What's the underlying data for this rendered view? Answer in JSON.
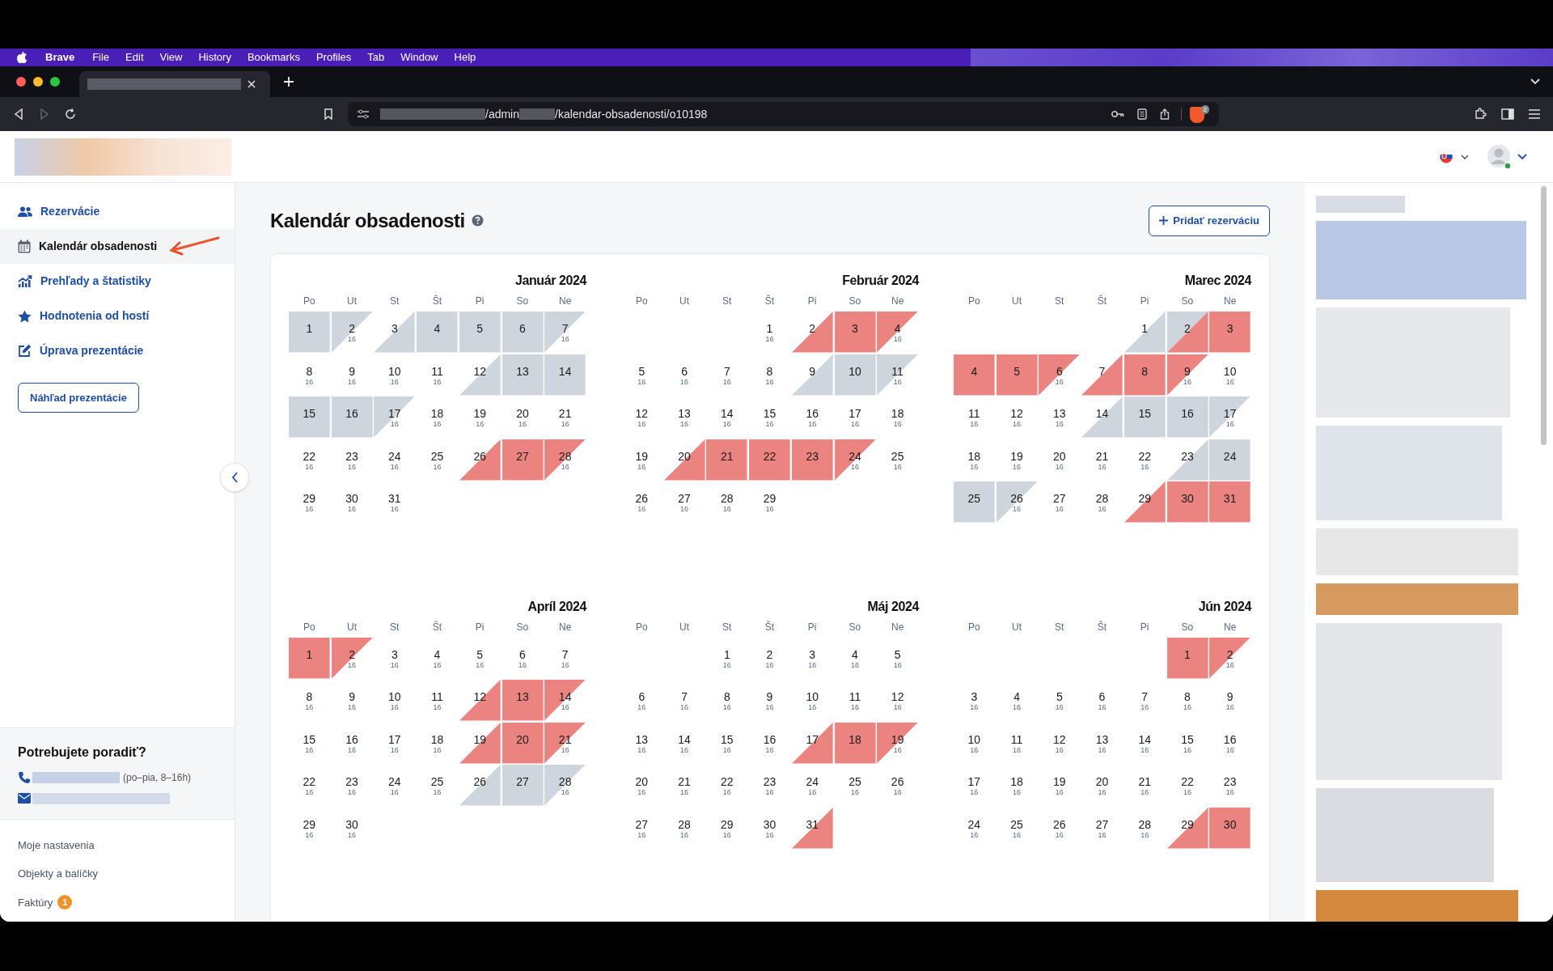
{
  "menu_bar": {
    "app": "Brave",
    "items": [
      "File",
      "Edit",
      "View",
      "History",
      "Bookmarks",
      "Profiles",
      "Tab",
      "Window",
      "Help"
    ]
  },
  "browser": {
    "url_parts": [
      "/admin",
      "/kalendar-obsadenosti/o10198"
    ],
    "shield_badge": "2"
  },
  "sidebar": {
    "items": [
      {
        "label": "Rezervácie",
        "selected": false
      },
      {
        "label": "Kalendár obsadenosti",
        "selected": true
      },
      {
        "label": "Prehľady a štatistiky",
        "selected": false
      },
      {
        "label": "Hodnotenia od hostí",
        "selected": false
      },
      {
        "label": "Úprava prezentácie",
        "selected": false
      }
    ],
    "preview_button": "Náhľad prezentácie",
    "help": {
      "title": "Potrebujete poradiť?",
      "phone_hours": "(po–pia, 8–16h)"
    },
    "links": [
      {
        "label": "Moje nastavenia"
      },
      {
        "label": "Objekty a balíčky"
      },
      {
        "label": "Faktúry",
        "badge": "1"
      }
    ]
  },
  "page": {
    "title": "Kalendár obsadenosti",
    "add_button": "Pridať rezerváciu"
  },
  "months": [
    {
      "title": "Január 2024",
      "weekdays": [
        "Po",
        "Ut",
        "St",
        "Št",
        "Pi",
        "So",
        "Ne"
      ],
      "weeks": [
        [
          {
            "day": "1",
            "am": {
              "color": "#cfd5dd"
            },
            "pm": {
              "color": "#cfd5dd"
            }
          },
          {
            "day": "2",
            "am": {
              "color": "#cfd5dd"
            },
            "price": "16"
          },
          {
            "day": "3",
            "pm": {
              "color": "#cfd5dd"
            }
          },
          {
            "day": "4",
            "am": {
              "color": "#cfd5dd"
            },
            "pm": {
              "color": "#cfd5dd"
            }
          },
          {
            "day": "5",
            "am": {
              "color": "#cfd5dd"
            },
            "pm": {
              "color": "#cfd5dd"
            }
          },
          {
            "day": "6",
            "am": {
              "color": "#cfd5dd"
            },
            "pm": {
              "color": "#cfd5dd"
            }
          },
          {
            "day": "7",
            "am": {
              "color": "#cfd5dd"
            },
            "price": "16"
          }
        ],
        [
          {
            "day": "8",
            "price": "16"
          },
          {
            "day": "9",
            "price": "16"
          },
          {
            "day": "10",
            "price": "16"
          },
          {
            "day": "11",
            "price": "16"
          },
          {
            "day": "12",
            "pm": {
              "color": "#cfd5dd"
            }
          },
          {
            "day": "13",
            "am": {
              "color": "#cfd5dd"
            },
            "pm": {
              "color": "#cfd5dd"
            }
          },
          {
            "day": "14",
            "am": {
              "color": "#cfd5dd"
            },
            "pm": {
              "color": "#cfd5dd"
            }
          }
        ],
        [
          {
            "day": "15",
            "am": {
              "color": "#cfd5dd"
            },
            "pm": {
              "color": "#cfd5dd"
            }
          },
          {
            "day": "16",
            "am": {
              "color": "#cfd5dd"
            },
            "pm": {
              "color": "#cfd5dd"
            }
          },
          {
            "day": "17",
            "am": {
              "color": "#cfd5dd"
            },
            "price": "16"
          },
          {
            "day": "18",
            "price": "16"
          },
          {
            "day": "19",
            "price": "16"
          },
          {
            "day": "20",
            "price": "16"
          },
          {
            "day": "21",
            "price": "16"
          }
        ],
        [
          {
            "day": "22",
            "price": "16"
          },
          {
            "day": "23",
            "price": "16"
          },
          {
            "day": "24",
            "price": "16"
          },
          {
            "day": "25",
            "price": "16"
          },
          {
            "day": "26",
            "pm": {
              "color": "#eb8480"
            }
          },
          {
            "day": "27",
            "am": {
              "color": "#eb8480"
            },
            "pm": {
              "color": "#eb8480"
            }
          },
          {
            "day": "28",
            "am": {
              "color": "#eb8480"
            },
            "price": "16"
          }
        ],
        [
          {
            "day": "29",
            "price": "16"
          },
          {
            "day": "30",
            "price": "16"
          },
          {
            "day": "31",
            "price": "16"
          }
        ]
      ]
    },
    {
      "title": "Február 2024",
      "weekdays": [
        "Po",
        "Ut",
        "St",
        "Št",
        "Pi",
        "So",
        "Ne"
      ],
      "weeks": [
        [
          {
            "day": "1",
            "price": "16"
          },
          {
            "day": "2",
            "pm": {
              "color": "#eb8480"
            }
          },
          {
            "day": "3",
            "am": {
              "color": "#eb8480"
            },
            "pm": {
              "color": "#eb8480"
            }
          },
          {
            "day": "4",
            "am": {
              "color": "#eb8480"
            },
            "price": "16"
          }
        ],
        [
          {
            "day": "5",
            "price": "16"
          },
          {
            "day": "6",
            "price": "16"
          },
          {
            "day": "7",
            "price": "16"
          },
          {
            "day": "8",
            "price": "16"
          },
          {
            "day": "9",
            "pm": {
              "color": "#cfd5dd"
            }
          },
          {
            "day": "10",
            "am": {
              "color": "#cfd5dd"
            },
            "pm": {
              "color": "#cfd5dd"
            }
          },
          {
            "day": "11",
            "am": {
              "color": "#cfd5dd"
            },
            "price": "16"
          }
        ],
        [
          {
            "day": "12",
            "price": "16"
          },
          {
            "day": "13",
            "price": "16"
          },
          {
            "day": "14",
            "price": "16"
          },
          {
            "day": "15",
            "price": "16"
          },
          {
            "day": "16",
            "price": "16"
          },
          {
            "day": "17",
            "price": "16"
          },
          {
            "day": "18",
            "price": "16"
          }
        ],
        [
          {
            "day": "19",
            "price": "16"
          },
          {
            "day": "20",
            "pm": {
              "color": "#eb8480"
            }
          },
          {
            "day": "21",
            "am": {
              "color": "#eb8480"
            },
            "pm": {
              "color": "#eb8480"
            }
          },
          {
            "day": "22",
            "am": {
              "color": "#eb8480"
            },
            "pm": {
              "color": "#eb8480"
            }
          },
          {
            "day": "23",
            "am": {
              "color": "#eb8480"
            },
            "pm": {
              "color": "#eb8480"
            }
          },
          {
            "day": "24",
            "am": {
              "color": "#eb8480"
            },
            "price": "16"
          },
          {
            "day": "25",
            "price": "16"
          }
        ],
        [
          {
            "day": "26",
            "price": "16"
          },
          {
            "day": "27",
            "price": "16"
          },
          {
            "day": "28",
            "price": "16"
          },
          {
            "day": "29",
            "price": "16"
          }
        ]
      ]
    },
    {
      "title": "Marec 2024",
      "weekdays": [
        "Po",
        "Ut",
        "St",
        "Št",
        "Pi",
        "So",
        "Ne"
      ],
      "weeks": [
        [
          {
            "day": "1",
            "pm": {
              "color": "#cfd5dd"
            }
          },
          {
            "day": "2",
            "am": {
              "color": "#cfd5dd"
            },
            "pm": {
              "color": "#eb8480"
            }
          },
          {
            "day": "3",
            "am": {
              "color": "#eb8480"
            },
            "pm": {
              "color": "#eb8480"
            }
          }
        ],
        [
          {
            "day": "4",
            "am": {
              "color": "#eb8480"
            },
            "pm": {
              "color": "#eb8480"
            }
          },
          {
            "day": "5",
            "am": {
              "color": "#eb8480"
            },
            "pm": {
              "color": "#eb8480"
            }
          },
          {
            "day": "6",
            "am": {
              "color": "#eb8480"
            },
            "price": "16"
          },
          {
            "day": "7",
            "pm": {
              "color": "#eb8480"
            }
          },
          {
            "day": "8",
            "am": {
              "color": "#eb8480"
            },
            "pm": {
              "color": "#eb8480"
            }
          },
          {
            "day": "9",
            "am": {
              "color": "#eb8480"
            },
            "price": "16"
          },
          {
            "day": "10",
            "price": "16"
          }
        ],
        [
          {
            "day": "11",
            "price": "16"
          },
          {
            "day": "12",
            "price": "16"
          },
          {
            "day": "13",
            "price": "16"
          },
          {
            "day": "14",
            "pm": {
              "color": "#cfd5dd"
            }
          },
          {
            "day": "15",
            "am": {
              "color": "#cfd5dd"
            },
            "pm": {
              "color": "#cfd5dd"
            }
          },
          {
            "day": "16",
            "am": {
              "color": "#cfd5dd"
            },
            "pm": {
              "color": "#cfd5dd"
            }
          },
          {
            "day": "17",
            "am": {
              "color": "#cfd5dd"
            },
            "price": "16"
          }
        ],
        [
          {
            "day": "18",
            "price": "16"
          },
          {
            "day": "19",
            "price": "16"
          },
          {
            "day": "20",
            "price": "16"
          },
          {
            "day": "21",
            "price": "16"
          },
          {
            "day": "22",
            "price": "16"
          },
          {
            "day": "23",
            "pm": {
              "color": "#cfd5dd"
            }
          },
          {
            "day": "24",
            "am": {
              "color": "#cfd5dd"
            },
            "pm": {
              "color": "#cfd5dd"
            }
          }
        ],
        [
          {
            "day": "25",
            "am": {
              "color": "#cfd5dd"
            },
            "pm": {
              "color": "#cfd5dd"
            }
          },
          {
            "day": "26",
            "am": {
              "color": "#cfd5dd"
            },
            "price": "16"
          },
          {
            "day": "27",
            "price": "16"
          },
          {
            "day": "28",
            "price": "16"
          },
          {
            "day": "29",
            "pm": {
              "color": "#eb8480"
            }
          },
          {
            "day": "30",
            "am": {
              "color": "#eb8480"
            },
            "pm": {
              "color": "#eb8480"
            }
          },
          {
            "day": "31",
            "am": {
              "color": "#eb8480"
            },
            "pm": {
              "color": "#eb8480"
            }
          }
        ]
      ]
    },
    {
      "title": "Apríl 2024",
      "weekdays": [
        "Po",
        "Ut",
        "St",
        "Št",
        "Pi",
        "So",
        "Ne"
      ],
      "weeks": [
        [
          {
            "day": "1",
            "am": {
              "color": "#eb8480"
            },
            "pm": {
              "color": "#eb8480"
            }
          },
          {
            "day": "2",
            "am": {
              "color": "#eb8480"
            },
            "price": "16"
          },
          {
            "day": "3",
            "price": "16"
          },
          {
            "day": "4",
            "price": "16"
          },
          {
            "day": "5",
            "price": "16"
          },
          {
            "day": "6",
            "price": "16"
          },
          {
            "day": "7",
            "price": "16"
          }
        ],
        [
          {
            "day": "8",
            "price": "16"
          },
          {
            "day": "9",
            "price": "16"
          },
          {
            "day": "10",
            "price": "16"
          },
          {
            "day": "11",
            "price": "16"
          },
          {
            "day": "12",
            "pm": {
              "color": "#eb8480"
            }
          },
          {
            "day": "13",
            "am": {
              "color": "#eb8480"
            },
            "pm": {
              "color": "#eb8480"
            }
          },
          {
            "day": "14",
            "am": {
              "color": "#eb8480"
            },
            "price": "16"
          }
        ],
        [
          {
            "day": "15",
            "price": "16"
          },
          {
            "day": "16",
            "price": "16"
          },
          {
            "day": "17",
            "price": "16"
          },
          {
            "day": "18",
            "price": "16"
          },
          {
            "day": "19",
            "pm": {
              "color": "#eb8480"
            }
          },
          {
            "day": "20",
            "am": {
              "color": "#eb8480"
            },
            "pm": {
              "color": "#eb8480"
            }
          },
          {
            "day": "21",
            "am": {
              "color": "#eb8480"
            },
            "price": "16"
          }
        ],
        [
          {
            "day": "22",
            "price": "16"
          },
          {
            "day": "23",
            "price": "16"
          },
          {
            "day": "24",
            "price": "16"
          },
          {
            "day": "25",
            "price": "16"
          },
          {
            "day": "26",
            "pm": {
              "color": "#cfd5dd"
            }
          },
          {
            "day": "27",
            "am": {
              "color": "#cfd5dd"
            },
            "pm": {
              "color": "#cfd5dd"
            }
          },
          {
            "day": "28",
            "am": {
              "color": "#cfd5dd"
            },
            "price": "16"
          }
        ],
        [
          {
            "day": "29",
            "price": "16"
          },
          {
            "day": "30",
            "price": "16"
          }
        ]
      ]
    },
    {
      "title": "Máj 2024",
      "weekdays": [
        "Po",
        "Ut",
        "St",
        "Št",
        "Pi",
        "So",
        "Ne"
      ],
      "weeks": [
        [
          {
            "day": "1",
            "price": "16"
          },
          {
            "day": "2",
            "price": "16"
          },
          {
            "day": "3",
            "price": "16"
          },
          {
            "day": "4",
            "price": "16"
          },
          {
            "day": "5",
            "price": "16"
          }
        ],
        [
          {
            "day": "6",
            "price": "16"
          },
          {
            "day": "7",
            "price": "16"
          },
          {
            "day": "8",
            "price": "16"
          },
          {
            "day": "9",
            "price": "16"
          },
          {
            "day": "10",
            "price": "16"
          },
          {
            "day": "11",
            "price": "16"
          },
          {
            "day": "12",
            "price": "16"
          }
        ],
        [
          {
            "day": "13",
            "price": "16"
          },
          {
            "day": "14",
            "price": "16"
          },
          {
            "day": "15",
            "price": "16"
          },
          {
            "day": "16",
            "price": "16"
          },
          {
            "day": "17",
            "pm": {
              "color": "#eb8480"
            }
          },
          {
            "day": "18",
            "am": {
              "color": "#eb8480"
            },
            "pm": {
              "color": "#eb8480"
            }
          },
          {
            "day": "19",
            "am": {
              "color": "#eb8480"
            },
            "price": "16"
          }
        ],
        [
          {
            "day": "20",
            "price": "16"
          },
          {
            "day": "21",
            "price": "16"
          },
          {
            "day": "22",
            "price": "16"
          },
          {
            "day": "23",
            "price": "16"
          },
          {
            "day": "24",
            "price": "16"
          },
          {
            "day": "25",
            "price": "16"
          },
          {
            "day": "26",
            "price": "16"
          }
        ],
        [
          {
            "day": "27",
            "price": "16"
          },
          {
            "day": "28",
            "price": "16"
          },
          {
            "day": "29",
            "price": "16"
          },
          {
            "day": "30",
            "price": "16"
          },
          {
            "day": "31",
            "pm": {
              "color": "#eb8480"
            }
          }
        ]
      ]
    },
    {
      "title": "Jún 2024",
      "weekdays": [
        "Po",
        "Ut",
        "St",
        "Št",
        "Pi",
        "So",
        "Ne"
      ],
      "weeks": [
        [
          {
            "day": "1",
            "am": {
              "color": "#eb8480"
            },
            "pm": {
              "color": "#eb8480"
            }
          },
          {
            "day": "2",
            "am": {
              "color": "#eb8480"
            },
            "price": "16"
          }
        ],
        [
          {
            "day": "3",
            "price": "16"
          },
          {
            "day": "4",
            "price": "16"
          },
          {
            "day": "5",
            "price": "16"
          },
          {
            "day": "6",
            "price": "16"
          },
          {
            "day": "7",
            "price": "16"
          },
          {
            "day": "8",
            "price": "16"
          },
          {
            "day": "9",
            "price": "16"
          }
        ],
        [
          {
            "day": "10",
            "price": "16"
          },
          {
            "day": "11",
            "price": "16"
          },
          {
            "day": "12",
            "price": "16"
          },
          {
            "day": "13",
            "price": "16"
          },
          {
            "day": "14",
            "price": "16"
          },
          {
            "day": "15",
            "price": "16"
          },
          {
            "day": "16",
            "price": "16"
          }
        ],
        [
          {
            "day": "17",
            "price": "16"
          },
          {
            "day": "18",
            "price": "16"
          },
          {
            "day": "19",
            "price": "16"
          },
          {
            "day": "20",
            "price": "16"
          },
          {
            "day": "21",
            "price": "16"
          },
          {
            "day": "22",
            "price": "16"
          },
          {
            "day": "23",
            "price": "16"
          }
        ],
        [
          {
            "day": "24",
            "price": "16"
          },
          {
            "day": "25",
            "price": "16"
          },
          {
            "day": "26",
            "price": "16"
          },
          {
            "day": "27",
            "price": "16"
          },
          {
            "day": "28",
            "price": "16"
          },
          {
            "day": "29",
            "pm": {
              "color": "#eb8480"
            }
          },
          {
            "day": "30",
            "am": {
              "color": "#eb8480"
            },
            "pm": {
              "color": "#eb8480"
            }
          }
        ]
      ]
    }
  ]
}
